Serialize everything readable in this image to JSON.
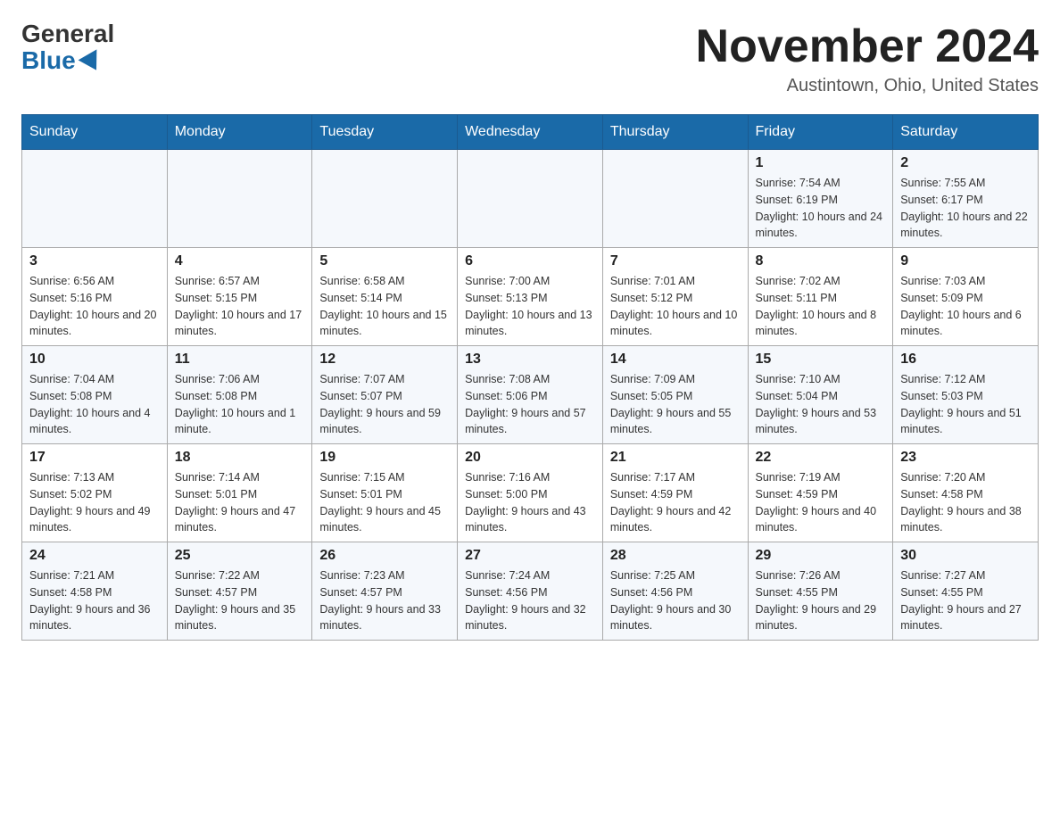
{
  "logo": {
    "general": "General",
    "blue": "Blue"
  },
  "title": {
    "month_year": "November 2024",
    "location": "Austintown, Ohio, United States"
  },
  "days_of_week": [
    "Sunday",
    "Monday",
    "Tuesday",
    "Wednesday",
    "Thursday",
    "Friday",
    "Saturday"
  ],
  "weeks": [
    [
      {
        "day": "",
        "info": ""
      },
      {
        "day": "",
        "info": ""
      },
      {
        "day": "",
        "info": ""
      },
      {
        "day": "",
        "info": ""
      },
      {
        "day": "",
        "info": ""
      },
      {
        "day": "1",
        "info": "Sunrise: 7:54 AM\nSunset: 6:19 PM\nDaylight: 10 hours and 24 minutes."
      },
      {
        "day": "2",
        "info": "Sunrise: 7:55 AM\nSunset: 6:17 PM\nDaylight: 10 hours and 22 minutes."
      }
    ],
    [
      {
        "day": "3",
        "info": "Sunrise: 6:56 AM\nSunset: 5:16 PM\nDaylight: 10 hours and 20 minutes."
      },
      {
        "day": "4",
        "info": "Sunrise: 6:57 AM\nSunset: 5:15 PM\nDaylight: 10 hours and 17 minutes."
      },
      {
        "day": "5",
        "info": "Sunrise: 6:58 AM\nSunset: 5:14 PM\nDaylight: 10 hours and 15 minutes."
      },
      {
        "day": "6",
        "info": "Sunrise: 7:00 AM\nSunset: 5:13 PM\nDaylight: 10 hours and 13 minutes."
      },
      {
        "day": "7",
        "info": "Sunrise: 7:01 AM\nSunset: 5:12 PM\nDaylight: 10 hours and 10 minutes."
      },
      {
        "day": "8",
        "info": "Sunrise: 7:02 AM\nSunset: 5:11 PM\nDaylight: 10 hours and 8 minutes."
      },
      {
        "day": "9",
        "info": "Sunrise: 7:03 AM\nSunset: 5:09 PM\nDaylight: 10 hours and 6 minutes."
      }
    ],
    [
      {
        "day": "10",
        "info": "Sunrise: 7:04 AM\nSunset: 5:08 PM\nDaylight: 10 hours and 4 minutes."
      },
      {
        "day": "11",
        "info": "Sunrise: 7:06 AM\nSunset: 5:08 PM\nDaylight: 10 hours and 1 minute."
      },
      {
        "day": "12",
        "info": "Sunrise: 7:07 AM\nSunset: 5:07 PM\nDaylight: 9 hours and 59 minutes."
      },
      {
        "day": "13",
        "info": "Sunrise: 7:08 AM\nSunset: 5:06 PM\nDaylight: 9 hours and 57 minutes."
      },
      {
        "day": "14",
        "info": "Sunrise: 7:09 AM\nSunset: 5:05 PM\nDaylight: 9 hours and 55 minutes."
      },
      {
        "day": "15",
        "info": "Sunrise: 7:10 AM\nSunset: 5:04 PM\nDaylight: 9 hours and 53 minutes."
      },
      {
        "day": "16",
        "info": "Sunrise: 7:12 AM\nSunset: 5:03 PM\nDaylight: 9 hours and 51 minutes."
      }
    ],
    [
      {
        "day": "17",
        "info": "Sunrise: 7:13 AM\nSunset: 5:02 PM\nDaylight: 9 hours and 49 minutes."
      },
      {
        "day": "18",
        "info": "Sunrise: 7:14 AM\nSunset: 5:01 PM\nDaylight: 9 hours and 47 minutes."
      },
      {
        "day": "19",
        "info": "Sunrise: 7:15 AM\nSunset: 5:01 PM\nDaylight: 9 hours and 45 minutes."
      },
      {
        "day": "20",
        "info": "Sunrise: 7:16 AM\nSunset: 5:00 PM\nDaylight: 9 hours and 43 minutes."
      },
      {
        "day": "21",
        "info": "Sunrise: 7:17 AM\nSunset: 4:59 PM\nDaylight: 9 hours and 42 minutes."
      },
      {
        "day": "22",
        "info": "Sunrise: 7:19 AM\nSunset: 4:59 PM\nDaylight: 9 hours and 40 minutes."
      },
      {
        "day": "23",
        "info": "Sunrise: 7:20 AM\nSunset: 4:58 PM\nDaylight: 9 hours and 38 minutes."
      }
    ],
    [
      {
        "day": "24",
        "info": "Sunrise: 7:21 AM\nSunset: 4:58 PM\nDaylight: 9 hours and 36 minutes."
      },
      {
        "day": "25",
        "info": "Sunrise: 7:22 AM\nSunset: 4:57 PM\nDaylight: 9 hours and 35 minutes."
      },
      {
        "day": "26",
        "info": "Sunrise: 7:23 AM\nSunset: 4:57 PM\nDaylight: 9 hours and 33 minutes."
      },
      {
        "day": "27",
        "info": "Sunrise: 7:24 AM\nSunset: 4:56 PM\nDaylight: 9 hours and 32 minutes."
      },
      {
        "day": "28",
        "info": "Sunrise: 7:25 AM\nSunset: 4:56 PM\nDaylight: 9 hours and 30 minutes."
      },
      {
        "day": "29",
        "info": "Sunrise: 7:26 AM\nSunset: 4:55 PM\nDaylight: 9 hours and 29 minutes."
      },
      {
        "day": "30",
        "info": "Sunrise: 7:27 AM\nSunset: 4:55 PM\nDaylight: 9 hours and 27 minutes."
      }
    ]
  ]
}
